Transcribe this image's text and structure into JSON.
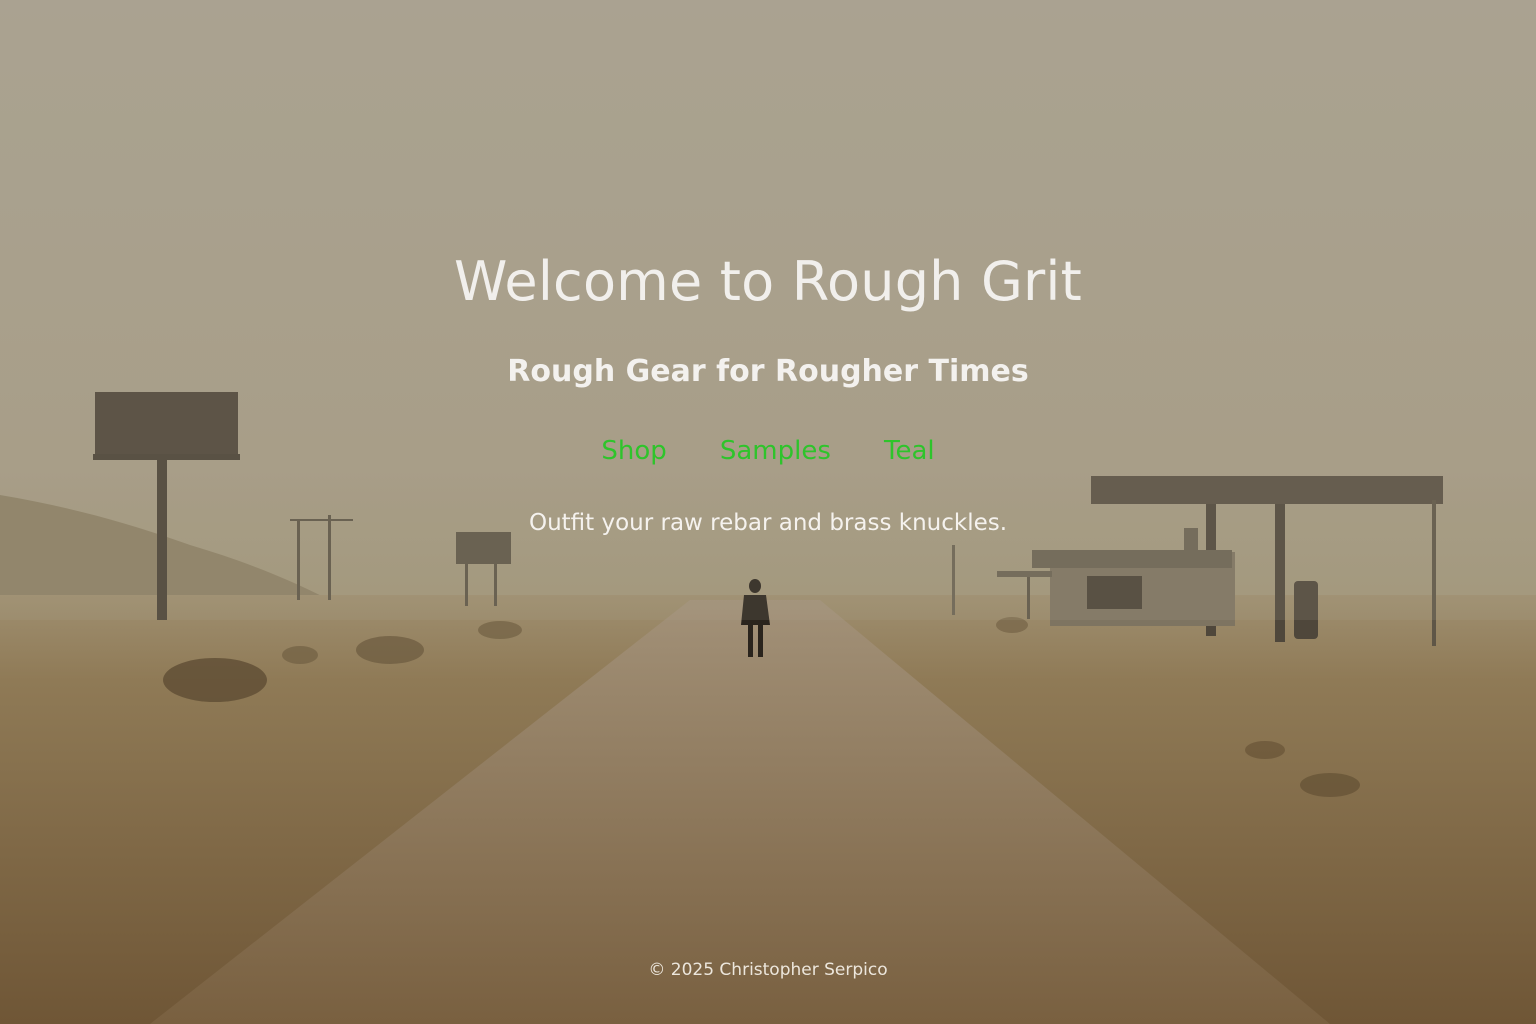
{
  "hero": {
    "title": "Welcome to Rough Grit",
    "tagline": "Rough Gear for Rougher Times",
    "blurb": "Outfit your raw rebar and brass knuckles."
  },
  "nav": {
    "items": [
      {
        "label": "Shop"
      },
      {
        "label": "Samples"
      },
      {
        "label": "Teal"
      }
    ],
    "link_color": "#2ec42b"
  },
  "footer": {
    "copyright": "© 2025 Christopher Serpico"
  },
  "background": {
    "sky_color": "#aaa18e",
    "ground_color": "#7d6440"
  }
}
